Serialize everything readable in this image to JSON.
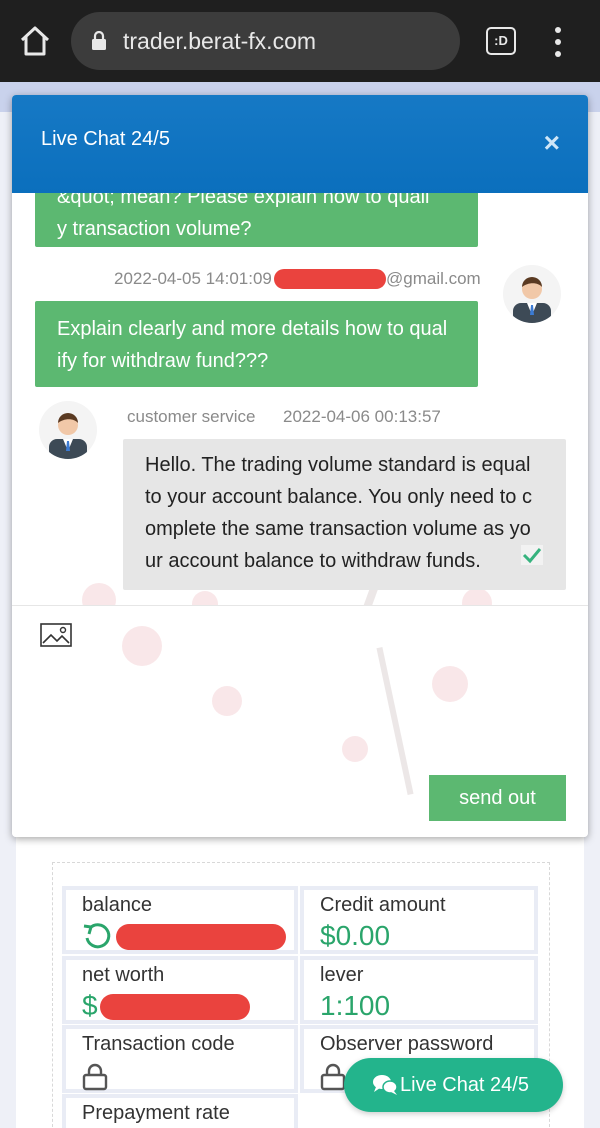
{
  "browser": {
    "url": "trader.berat-fx.com",
    "tab_label": ":D"
  },
  "chat": {
    "title": "Live Chat 24/5",
    "close_label": "×",
    "messages": [
      {
        "from": "user",
        "line1": "&quot; mean? Please explain how to quali",
        "line2": "y transaction volume?"
      },
      {
        "from": "user",
        "timestamp": "2022-04-05 14:01:09",
        "email_suffix": "@gmail.com",
        "line1": "Explain clearly and more details how to qual",
        "line2": "ify for withdraw fund???"
      },
      {
        "from": "agent",
        "sender": "customer service",
        "timestamp": "2022-04-06 00:13:57",
        "line1": "Hello. The trading volume standard is equal",
        "line2": "to your account balance. You only need to c",
        "line3": "omplete the same transaction volume as yo",
        "line4": "ur account balance to withdraw funds."
      }
    ],
    "send_label": "send out"
  },
  "account": {
    "balance_label": "balance",
    "credit_label": "Credit amount",
    "credit_value": "$0.00",
    "net_worth_label": "net worth",
    "net_worth_value_prefix": "$",
    "lever_label": "lever",
    "lever_value": "1:100",
    "transaction_code_label": "Transaction code",
    "observer_password_label": "Observer password",
    "prepayment_label": "Prepayment rate"
  },
  "floating_chat": {
    "label": "Live Chat 24/5"
  },
  "colors": {
    "header_blue": "#0b6fbd",
    "bubble_green": "#5cb871",
    "float_green": "#23b48c",
    "value_green": "#2aa56b"
  }
}
